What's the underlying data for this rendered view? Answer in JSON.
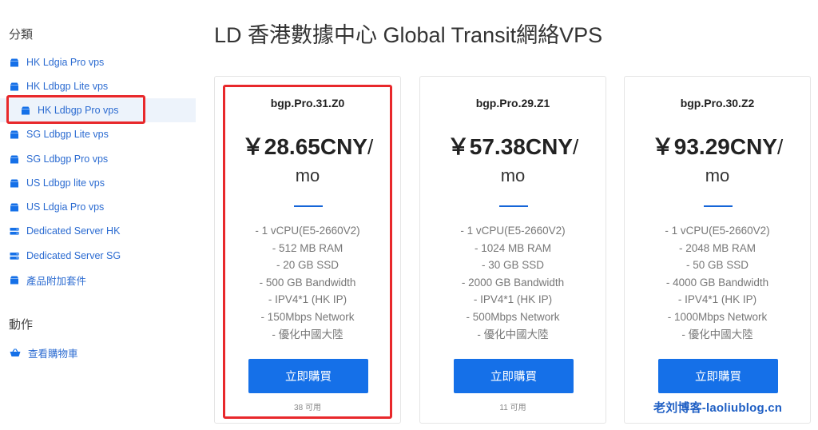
{
  "sidebar": {
    "categories_title": "分類",
    "items": [
      {
        "label": "HK Ldgia Pro vps",
        "icon": "box-icon"
      },
      {
        "label": "HK Ldbgp Lite vps",
        "icon": "box-icon"
      },
      {
        "label": "HK Ldbgp Pro vps",
        "icon": "box-icon",
        "active": true
      },
      {
        "label": "SG Ldbgp Lite vps",
        "icon": "box-icon"
      },
      {
        "label": "SG Ldbgp Pro vps",
        "icon": "box-icon"
      },
      {
        "label": "US Ldbgp lite vps",
        "icon": "box-icon"
      },
      {
        "label": "US Ldgia Pro vps",
        "icon": "box-icon"
      },
      {
        "label": "Dedicated Server HK",
        "icon": "server-icon"
      },
      {
        "label": "Dedicated Server SG",
        "icon": "server-icon"
      },
      {
        "label": "產品附加套件",
        "icon": "box-icon"
      }
    ],
    "actions_title": "動作",
    "actions": [
      {
        "label": "查看購物車",
        "icon": "cart-icon"
      }
    ]
  },
  "page": {
    "title": "LD 香港數據中心 Global Transit網絡VPS"
  },
  "products": [
    {
      "name": "bgp.Pro.31.Z0",
      "price": "￥28.65CNY",
      "slash": "/",
      "cycle": "mo",
      "features": [
        "- 1 vCPU(E5-2660V2)",
        "- 512 MB RAM",
        "- 20 GB SSD",
        "- 500 GB Bandwidth",
        "- IPV4*1 (HK IP)",
        "- 150Mbps Network",
        "- 優化中國大陸"
      ],
      "buy_label": "立即購買",
      "availability": "38 可用"
    },
    {
      "name": "bgp.Pro.29.Z1",
      "price": "￥57.38CNY",
      "slash": "/",
      "cycle": "mo",
      "features": [
        "- 1 vCPU(E5-2660V2)",
        "- 1024 MB RAM",
        "- 30 GB SSD",
        "- 2000 GB Bandwidth",
        "- IPV4*1 (HK IP)",
        "- 500Mbps Network",
        "- 優化中國大陸"
      ],
      "buy_label": "立即購買",
      "availability": "11 可用"
    },
    {
      "name": "bgp.Pro.30.Z2",
      "price": "￥93.29CNY",
      "slash": "/",
      "cycle": "mo",
      "features": [
        "- 1 vCPU(E5-2660V2)",
        "- 2048 MB RAM",
        "- 50 GB SSD",
        "- 4000 GB Bandwidth",
        "- IPV4*1 (HK IP)",
        "- 1000Mbps Network",
        "- 優化中國大陸"
      ],
      "buy_label": "立即購買",
      "availability": ""
    }
  ],
  "watermark": "老刘博客-laoliublog.cn",
  "colors": {
    "accent": "#1570e8",
    "link": "#2b6bd1",
    "highlight_box": "#e8282b",
    "active_bg": "#edf3fb"
  }
}
